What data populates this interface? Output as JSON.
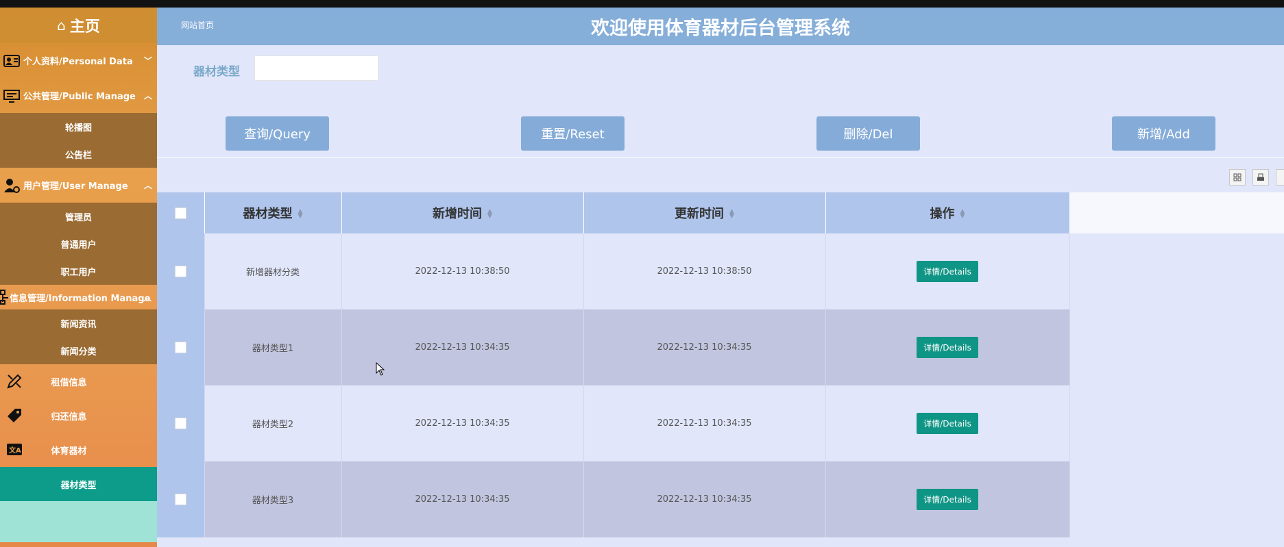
{
  "sidebar": {
    "home": "主页",
    "menus": [
      {
        "label": "个人资料/Personal Data",
        "icon": "id-card-icon"
      },
      {
        "label": "公共管理/Public Manage",
        "icon": "monitor-icon",
        "items": [
          "轮播图",
          "公告栏"
        ]
      },
      {
        "label": "用户管理/User Manage",
        "icon": "user-gear-icon",
        "items": [
          "管理员",
          "普通用户",
          "职工用户"
        ]
      },
      {
        "label": "信息管理/Information Manage",
        "icon": "sitemap-icon",
        "items": [
          "新闻资讯",
          "新闻分类"
        ]
      }
    ],
    "plain": [
      {
        "label": "租借信息",
        "icon": "pencil-ruler-icon"
      },
      {
        "label": "归还信息",
        "icon": "tag-icon"
      },
      {
        "label": "体育器材",
        "icon": "translate-icon"
      }
    ],
    "active": "器材类型"
  },
  "header": {
    "breadcrumb": "网站首页",
    "title": "欢迎使用体育器材后台管理系统"
  },
  "search": {
    "label": "器材类型",
    "value": ""
  },
  "buttons": {
    "query": "查询/Query",
    "reset": "重置/Reset",
    "del": "删除/Del",
    "add": "新增/Add"
  },
  "table": {
    "headers": [
      "器材类型",
      "新增时间",
      "更新时间",
      "操作"
    ],
    "detail_label": "详情/Details",
    "rows": [
      {
        "type": "新增器材分类",
        "created": "2022-12-13 10:38:50",
        "updated": "2022-12-13 10:38:50"
      },
      {
        "type": "器材类型1",
        "created": "2022-12-13 10:34:35",
        "updated": "2022-12-13 10:34:35"
      },
      {
        "type": "器材类型2",
        "created": "2022-12-13 10:34:35",
        "updated": "2022-12-13 10:34:35"
      },
      {
        "type": "器材类型3",
        "created": "2022-12-13 10:34:35",
        "updated": "2022-12-13 10:34:35"
      }
    ]
  },
  "colors": {
    "header_bg": "#85aed9",
    "button_bg": "#85acd8",
    "detail_btn": "#0f9585",
    "sidebar_active": "#0d9c8a"
  }
}
